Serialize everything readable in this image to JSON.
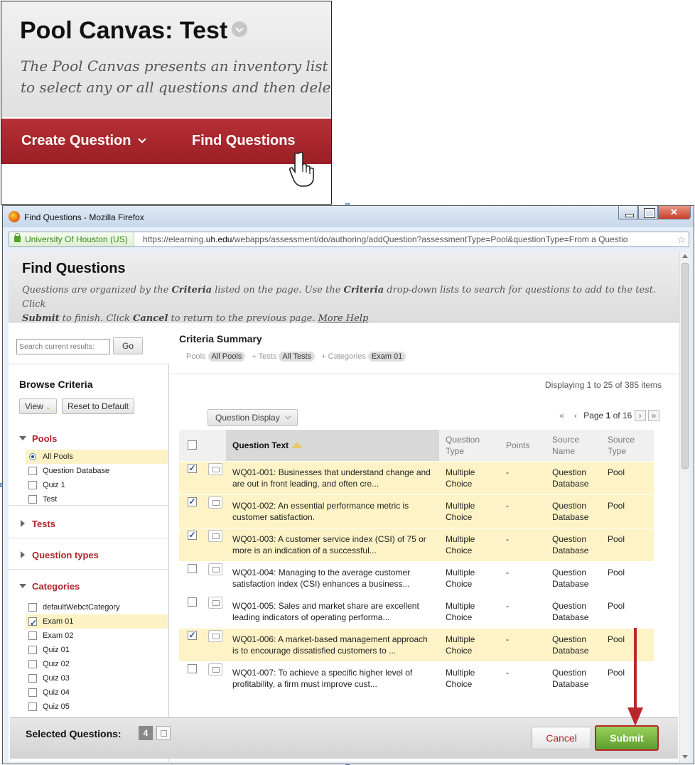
{
  "top_panel": {
    "title": "Pool Canvas: Test",
    "description_line1": "The Pool Canvas presents an inventory list of qu",
    "description_line2": "to select any or all questions and then delete ther",
    "create_question": "Create Question",
    "find_questions": "Find Questions"
  },
  "browser": {
    "window_title": "Find Questions - Mozilla Firefox",
    "site_identity": "University Of Houston (US)",
    "url_prefix": "https://elearning.",
    "url_domain": "uh.edu",
    "url_suffix": "/webapps/assessment/do/authoring/addQuestion?assessmentType=Pool&questionType=From a Questio"
  },
  "page": {
    "title": "Find Questions",
    "instructions": {
      "p1": "Questions are organized by the ",
      "b1": "Criteria",
      "p2": " listed on the page. Use the ",
      "b2": "Criteria",
      "p3": " drop-down lists to search for questions to add to the test. Click",
      "b3": "Submit",
      "p4": " to finish. Click ",
      "b4": "Cancel",
      "p5": " to return to the previous page. ",
      "more_help": "More Help"
    }
  },
  "sidebar": {
    "search_placeholder": "Search current results:",
    "go": "Go",
    "browse_criteria": "Browse Criteria",
    "view": "View",
    "reset": "Reset to Default",
    "pools_heading": "Pools",
    "pools": [
      {
        "label": "All Pools",
        "selected": true
      },
      {
        "label": "Question Database",
        "selected": false
      },
      {
        "label": "Quiz 1",
        "selected": false
      },
      {
        "label": "Test",
        "selected": false
      }
    ],
    "tests_heading": "Tests",
    "question_types_heading": "Question types",
    "categories_heading": "Categories",
    "categories": [
      {
        "label": "defaultWebctCategory",
        "checked": false
      },
      {
        "label": "Exam 01",
        "checked": true
      },
      {
        "label": "Exam 02",
        "checked": false
      },
      {
        "label": "Quiz 01",
        "checked": false
      },
      {
        "label": "Quiz 02",
        "checked": false
      },
      {
        "label": "Quiz 03",
        "checked": false
      },
      {
        "label": "Quiz 04",
        "checked": false
      },
      {
        "label": "Quiz 05",
        "checked": false
      }
    ]
  },
  "criteria_summary": {
    "title": "Criteria Summary",
    "pools_label": "Pools",
    "pools_value": "All Pools",
    "tests_label": "+ Tests",
    "tests_value": "All Tests",
    "categories_label": "+ Categories",
    "categories_value": "Exam 01"
  },
  "results": {
    "displaying": "Displaying 1 to 25 of 385 items",
    "question_display": "Question Display",
    "page_label": "Page",
    "page_current": "1",
    "page_of": "of",
    "page_total": "16",
    "columns": [
      "Question Text",
      "Question Type",
      "Points",
      "Source Name",
      "Source Type"
    ],
    "rows": [
      {
        "checked": true,
        "text": "WQ01-001: Businesses that understand change and are out in front leading, and often cre...",
        "type": "Multiple Choice",
        "points": "-",
        "source_name": "Question Database",
        "source_type": "Pool"
      },
      {
        "checked": true,
        "text": "WQ01-002: An essential performance metric is customer satisfaction.",
        "type": "Multiple Choice",
        "points": "-",
        "source_name": "Question Database",
        "source_type": "Pool"
      },
      {
        "checked": true,
        "text": "WQ01-003: A customer service index (CSI) of 75 or more is an indication of a successful...",
        "type": "Multiple Choice",
        "points": "-",
        "source_name": "Question Database",
        "source_type": "Pool"
      },
      {
        "checked": false,
        "text": "WQ01-004: Managing to the average customer satisfaction index (CSI) enhances a business...",
        "type": "Multiple Choice",
        "points": "-",
        "source_name": "Question Database",
        "source_type": "Pool"
      },
      {
        "checked": false,
        "text": "WQ01-005: Sales and market share are excellent leading indicators of operating performa...",
        "type": "Multiple Choice",
        "points": "-",
        "source_name": "Question Database",
        "source_type": "Pool"
      },
      {
        "checked": true,
        "text": "WQ01-006: A market-based management approach is to encourage dissatisfied customers to ...",
        "type": "Multiple Choice",
        "points": "-",
        "source_name": "Question Database",
        "source_type": "Pool"
      },
      {
        "checked": false,
        "text": "WQ01-007: To achieve a specific higher level of profitability, a firm must improve cust...",
        "type": "Multiple Choice",
        "points": "-",
        "source_name": "Question Database",
        "source_type": "Pool"
      }
    ]
  },
  "bottom": {
    "selected_label": "Selected Questions:",
    "selected_count": "4",
    "cancel": "Cancel",
    "submit": "Submit"
  },
  "colors": {
    "brand_red": "#b0252b",
    "highlight_yellow": "#fdf3c6",
    "submit_green": "#6fb038",
    "arrow_red": "#b9272b"
  }
}
